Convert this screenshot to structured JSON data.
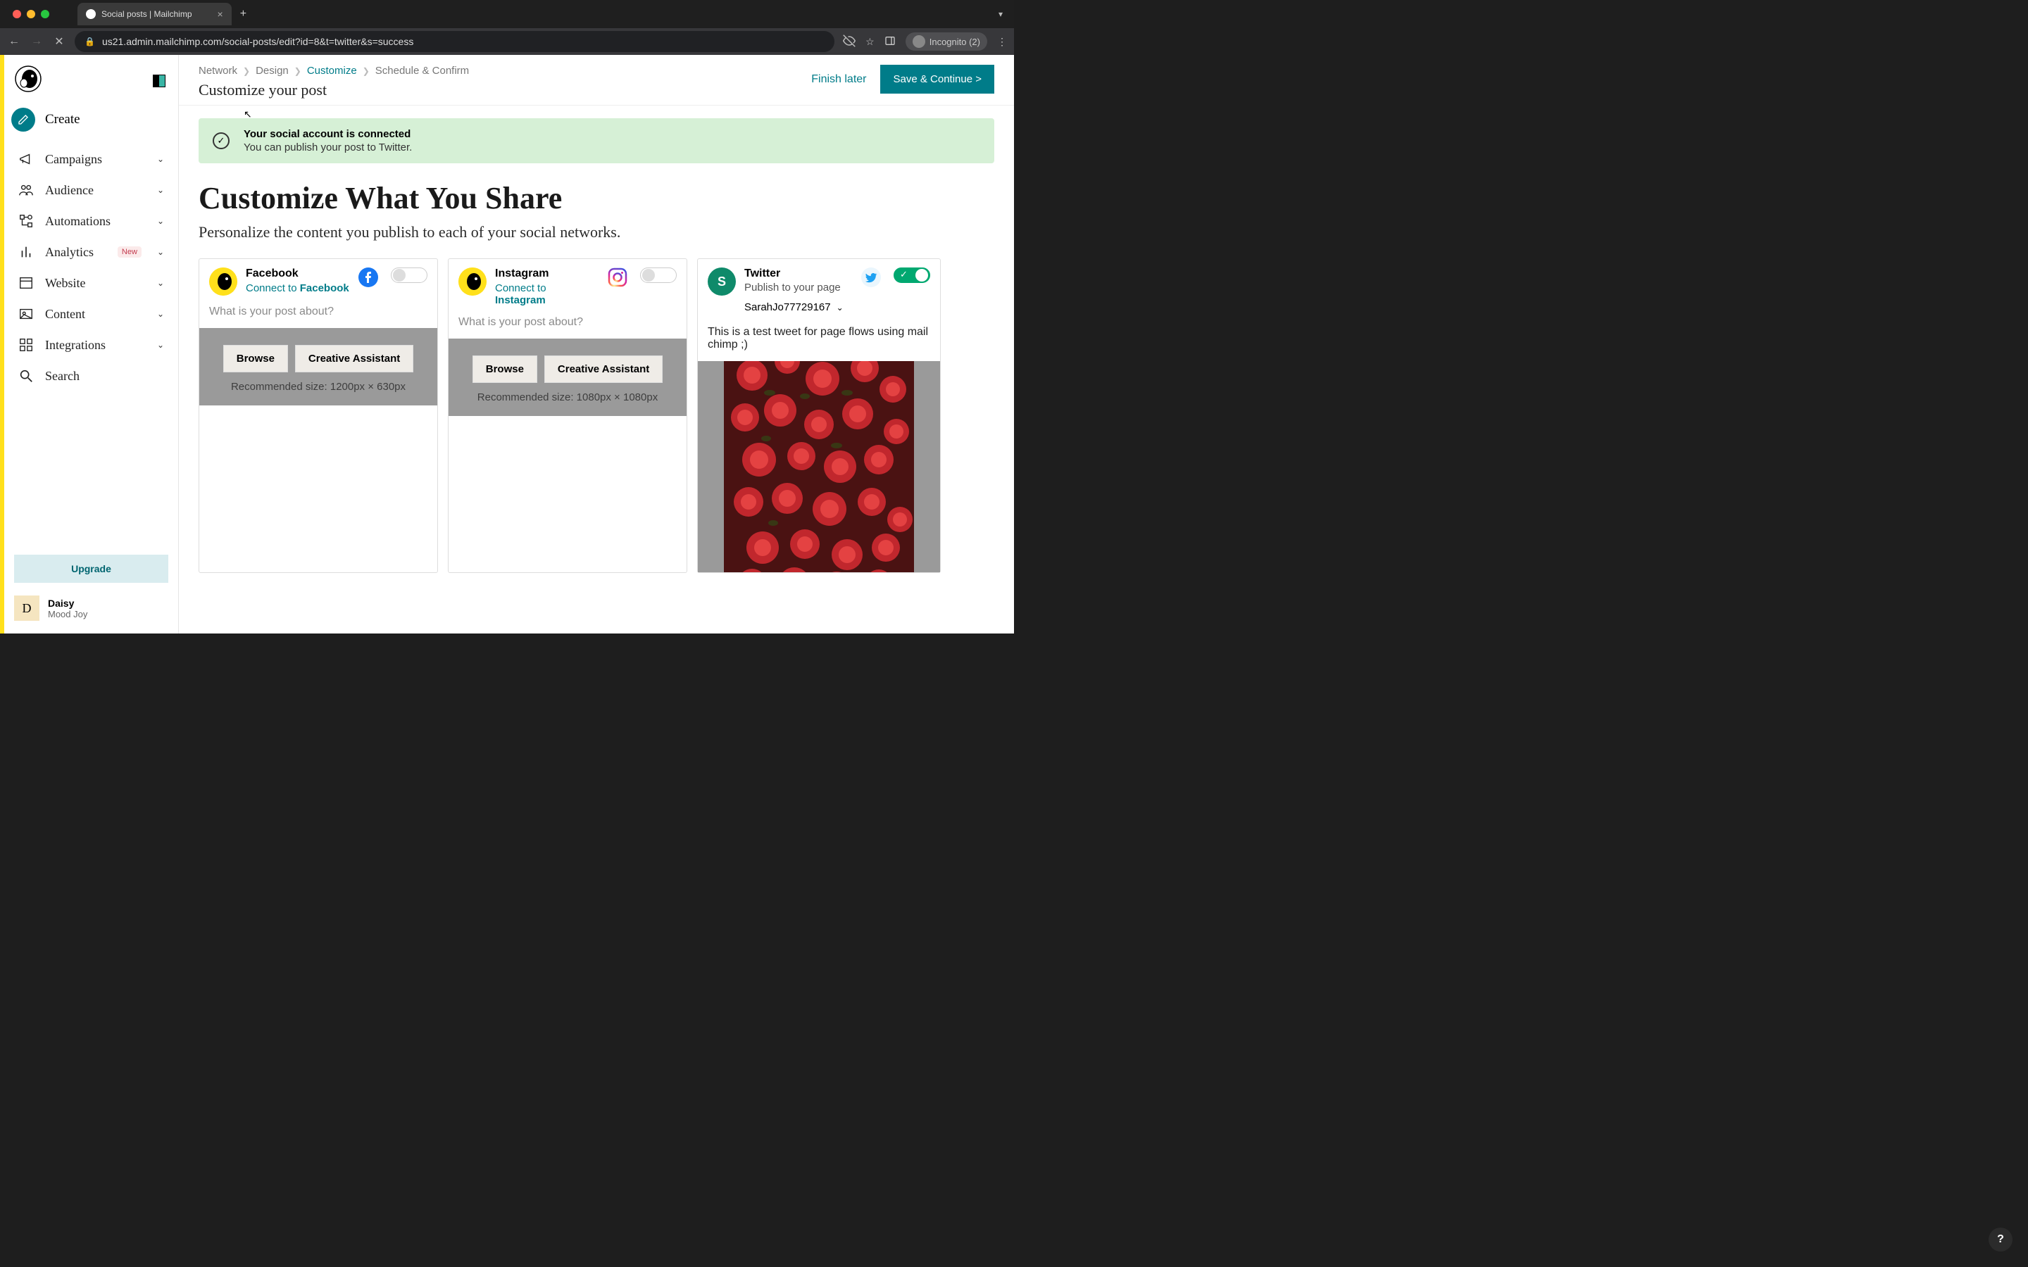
{
  "browser": {
    "tab_title": "Social posts | Mailchimp",
    "url": "us21.admin.mailchimp.com/social-posts/edit?id=8&t=twitter&s=success",
    "incognito_label": "Incognito (2)"
  },
  "sidebar": {
    "create_label": "Create",
    "items": [
      {
        "label": "Campaigns",
        "icon": "megaphone",
        "expandable": true
      },
      {
        "label": "Audience",
        "icon": "people",
        "expandable": true
      },
      {
        "label": "Automations",
        "icon": "flow",
        "expandable": true
      },
      {
        "label": "Analytics",
        "icon": "bars",
        "expandable": true,
        "badge": "New"
      },
      {
        "label": "Website",
        "icon": "window",
        "expandable": true
      },
      {
        "label": "Content",
        "icon": "image",
        "expandable": true
      },
      {
        "label": "Integrations",
        "icon": "grid",
        "expandable": true
      },
      {
        "label": "Search",
        "icon": "search",
        "expandable": false
      }
    ],
    "upgrade_label": "Upgrade",
    "user": {
      "initial": "D",
      "name": "Daisy",
      "sub": "Mood Joy"
    }
  },
  "breadcrumbs": [
    "Network",
    "Design",
    "Customize",
    "Schedule & Confirm"
  ],
  "breadcrumb_active_index": 2,
  "page_subtitle": "Customize your post",
  "actions": {
    "finish_later": "Finish later",
    "save_continue": "Save & Continue >"
  },
  "alert": {
    "title": "Your social account is connected",
    "body": "You can publish your post to Twitter."
  },
  "heading": "Customize What You Share",
  "lead": "Personalize the content you publish to each of your social networks.",
  "cards": {
    "facebook": {
      "title": "Facebook",
      "connect_prefix": "Connect to ",
      "connect_platform": "Facebook",
      "placeholder": "What is your post about?",
      "browse": "Browse",
      "assistant": "Creative Assistant",
      "rec_size": "Recommended size: 1200px × 630px",
      "enabled": false
    },
    "instagram": {
      "title": "Instagram",
      "connect_prefix": "Connect to ",
      "connect_platform": "Instagram",
      "placeholder": "What is your post about?",
      "browse": "Browse",
      "assistant": "Creative Assistant",
      "rec_size": "Recommended size: 1080px × 1080px",
      "enabled": false
    },
    "twitter": {
      "title": "Twitter",
      "subtitle": "Publish to your page",
      "account": "SarahJo77729167",
      "post_text": "This is a test tweet for page flows using mail chimp ;)",
      "enabled": true,
      "avatar_initial": "S"
    }
  },
  "help_label": "?"
}
